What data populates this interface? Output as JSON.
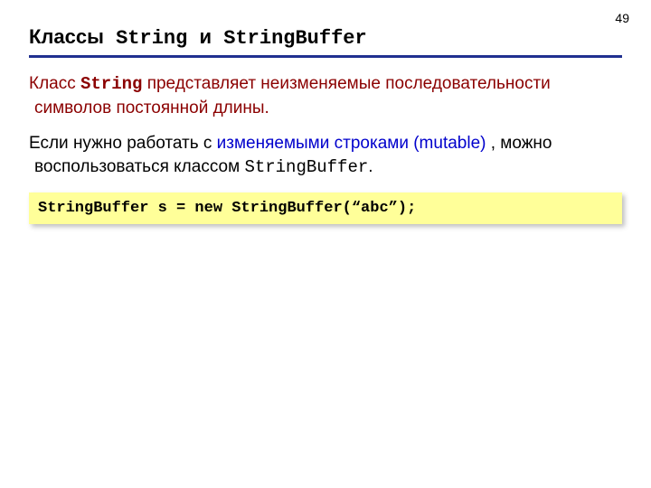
{
  "page_number": "49",
  "title": {
    "prefix": "Классы",
    "code1": " String ",
    "mid": "и",
    "code2": " StringBuffer"
  },
  "para1": {
    "t1": "Класс ",
    "code": "String",
    "t2": " представляет неизменяемые последовательности символов постоянной длины."
  },
  "para2": {
    "t1": "Если нужно работать с ",
    "blue": "изменяемыми строками (mutable)",
    "t2": " , можно воспользоваться классом ",
    "code": "StringBuffer",
    "t3": "."
  },
  "code_block": "StringBuffer s = new StringBuffer(“abc”);"
}
